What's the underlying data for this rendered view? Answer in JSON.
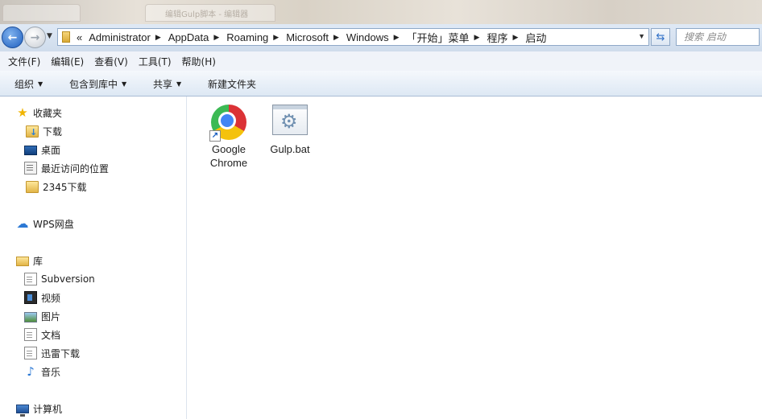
{
  "window": {
    "background_tab_title": "编辑Gulp脚本 - 编辑器"
  },
  "nav": {
    "back_glyph": "←",
    "forward_glyph": "→",
    "dropdown_glyph": "▼"
  },
  "address": {
    "lead": "«",
    "crumbs": [
      "Administrator",
      "AppData",
      "Roaming",
      "Microsoft",
      "Windows",
      "「开始」菜单",
      "程序",
      "启动"
    ],
    "separator": "▶",
    "dropdown_glyph": "▼",
    "refresh_glyph": "⇆"
  },
  "search": {
    "placeholder": "搜索 启动"
  },
  "menu": {
    "items": [
      "文件(F)",
      "编辑(E)",
      "查看(V)",
      "工具(T)",
      "帮助(H)"
    ]
  },
  "toolbar": {
    "organize": "组织",
    "include_in_library": "包含到库中",
    "share": "共享",
    "new_folder": "新建文件夹",
    "arrow": "▼"
  },
  "sidebar": {
    "favorites": {
      "label": "收藏夹",
      "items": [
        "下载",
        "桌面",
        "最近访问的位置",
        "2345下载"
      ]
    },
    "wps": {
      "label": "WPS网盘"
    },
    "libraries": {
      "label": "库",
      "items": [
        "Subversion",
        "视频",
        "图片",
        "文档",
        "迅雷下载",
        "音乐"
      ]
    },
    "computer": {
      "label": "计算机"
    },
    "icons": {
      "star": "★",
      "cloud": "☁",
      "music": "♪"
    }
  },
  "files": [
    {
      "name_line1": "Google",
      "name_line2": "Chrome",
      "icon": "chrome-icon"
    },
    {
      "name_line1": "Gulp.bat",
      "icon": "batch-file-icon"
    }
  ],
  "file_icons": {
    "shortcut_arrow": "↗",
    "gear": "⚙"
  }
}
